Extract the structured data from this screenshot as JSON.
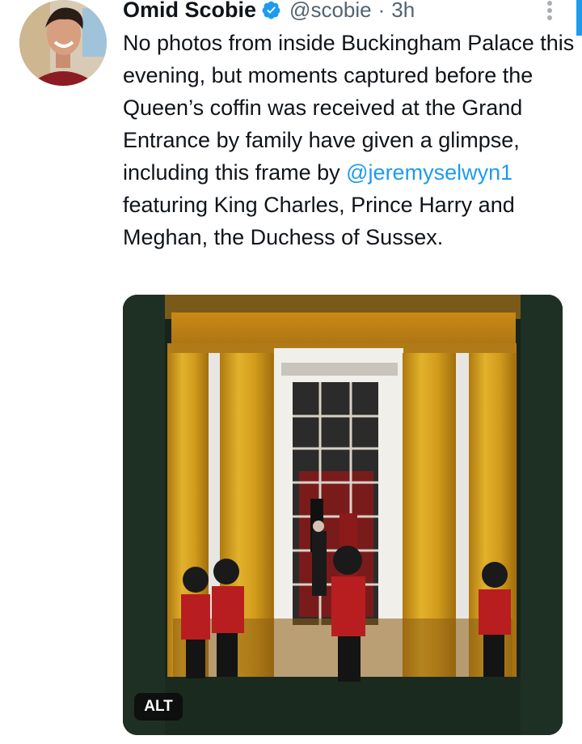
{
  "tweet": {
    "author_name": "Omid Scobie",
    "handle": "@scobie",
    "separator": "·",
    "time": "3h",
    "text_before": "No photos from inside Buckingham Palace this evening, but moments captured before the Queen’s coffin was received at the Grand Entrance by family have given a glimpse, including this frame by ",
    "mention": "@jeremyselwyn1",
    "text_after": " featuring King Charles, Prince Harry and Meghan, the Duchess of Sussex.",
    "media_alt_badge": "ALT"
  },
  "icons": {
    "verified": "verified-badge-icon",
    "more": "more-options-icon"
  },
  "colors": {
    "accent": "#1d9bf0",
    "text": "#0f1419",
    "secondary": "#536471",
    "curtain": "#d9a520",
    "tunic": "#b81e20"
  }
}
